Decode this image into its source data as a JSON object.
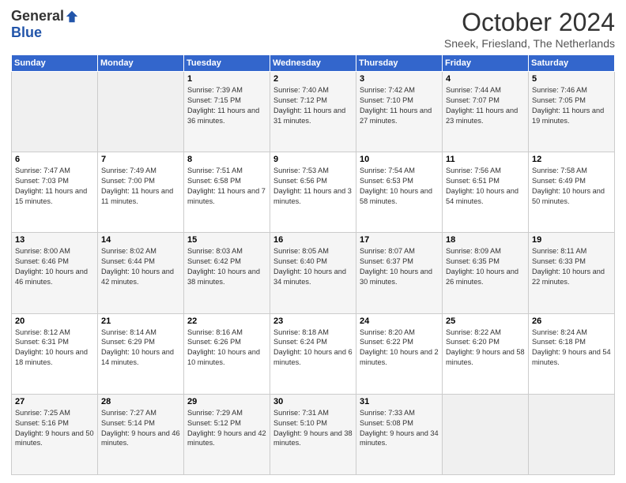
{
  "logo": {
    "general": "General",
    "blue": "Blue"
  },
  "title": "October 2024",
  "subtitle": "Sneek, Friesland, The Netherlands",
  "weekdays": [
    "Sunday",
    "Monday",
    "Tuesday",
    "Wednesday",
    "Thursday",
    "Friday",
    "Saturday"
  ],
  "weeks": [
    [
      {
        "day": "",
        "info": ""
      },
      {
        "day": "",
        "info": ""
      },
      {
        "day": "1",
        "info": "Sunrise: 7:39 AM\nSunset: 7:15 PM\nDaylight: 11 hours and 36 minutes."
      },
      {
        "day": "2",
        "info": "Sunrise: 7:40 AM\nSunset: 7:12 PM\nDaylight: 11 hours and 31 minutes."
      },
      {
        "day": "3",
        "info": "Sunrise: 7:42 AM\nSunset: 7:10 PM\nDaylight: 11 hours and 27 minutes."
      },
      {
        "day": "4",
        "info": "Sunrise: 7:44 AM\nSunset: 7:07 PM\nDaylight: 11 hours and 23 minutes."
      },
      {
        "day": "5",
        "info": "Sunrise: 7:46 AM\nSunset: 7:05 PM\nDaylight: 11 hours and 19 minutes."
      }
    ],
    [
      {
        "day": "6",
        "info": "Sunrise: 7:47 AM\nSunset: 7:03 PM\nDaylight: 11 hours and 15 minutes."
      },
      {
        "day": "7",
        "info": "Sunrise: 7:49 AM\nSunset: 7:00 PM\nDaylight: 11 hours and 11 minutes."
      },
      {
        "day": "8",
        "info": "Sunrise: 7:51 AM\nSunset: 6:58 PM\nDaylight: 11 hours and 7 minutes."
      },
      {
        "day": "9",
        "info": "Sunrise: 7:53 AM\nSunset: 6:56 PM\nDaylight: 11 hours and 3 minutes."
      },
      {
        "day": "10",
        "info": "Sunrise: 7:54 AM\nSunset: 6:53 PM\nDaylight: 10 hours and 58 minutes."
      },
      {
        "day": "11",
        "info": "Sunrise: 7:56 AM\nSunset: 6:51 PM\nDaylight: 10 hours and 54 minutes."
      },
      {
        "day": "12",
        "info": "Sunrise: 7:58 AM\nSunset: 6:49 PM\nDaylight: 10 hours and 50 minutes."
      }
    ],
    [
      {
        "day": "13",
        "info": "Sunrise: 8:00 AM\nSunset: 6:46 PM\nDaylight: 10 hours and 46 minutes."
      },
      {
        "day": "14",
        "info": "Sunrise: 8:02 AM\nSunset: 6:44 PM\nDaylight: 10 hours and 42 minutes."
      },
      {
        "day": "15",
        "info": "Sunrise: 8:03 AM\nSunset: 6:42 PM\nDaylight: 10 hours and 38 minutes."
      },
      {
        "day": "16",
        "info": "Sunrise: 8:05 AM\nSunset: 6:40 PM\nDaylight: 10 hours and 34 minutes."
      },
      {
        "day": "17",
        "info": "Sunrise: 8:07 AM\nSunset: 6:37 PM\nDaylight: 10 hours and 30 minutes."
      },
      {
        "day": "18",
        "info": "Sunrise: 8:09 AM\nSunset: 6:35 PM\nDaylight: 10 hours and 26 minutes."
      },
      {
        "day": "19",
        "info": "Sunrise: 8:11 AM\nSunset: 6:33 PM\nDaylight: 10 hours and 22 minutes."
      }
    ],
    [
      {
        "day": "20",
        "info": "Sunrise: 8:12 AM\nSunset: 6:31 PM\nDaylight: 10 hours and 18 minutes."
      },
      {
        "day": "21",
        "info": "Sunrise: 8:14 AM\nSunset: 6:29 PM\nDaylight: 10 hours and 14 minutes."
      },
      {
        "day": "22",
        "info": "Sunrise: 8:16 AM\nSunset: 6:26 PM\nDaylight: 10 hours and 10 minutes."
      },
      {
        "day": "23",
        "info": "Sunrise: 8:18 AM\nSunset: 6:24 PM\nDaylight: 10 hours and 6 minutes."
      },
      {
        "day": "24",
        "info": "Sunrise: 8:20 AM\nSunset: 6:22 PM\nDaylight: 10 hours and 2 minutes."
      },
      {
        "day": "25",
        "info": "Sunrise: 8:22 AM\nSunset: 6:20 PM\nDaylight: 9 hours and 58 minutes."
      },
      {
        "day": "26",
        "info": "Sunrise: 8:24 AM\nSunset: 6:18 PM\nDaylight: 9 hours and 54 minutes."
      }
    ],
    [
      {
        "day": "27",
        "info": "Sunrise: 7:25 AM\nSunset: 5:16 PM\nDaylight: 9 hours and 50 minutes."
      },
      {
        "day": "28",
        "info": "Sunrise: 7:27 AM\nSunset: 5:14 PM\nDaylight: 9 hours and 46 minutes."
      },
      {
        "day": "29",
        "info": "Sunrise: 7:29 AM\nSunset: 5:12 PM\nDaylight: 9 hours and 42 minutes."
      },
      {
        "day": "30",
        "info": "Sunrise: 7:31 AM\nSunset: 5:10 PM\nDaylight: 9 hours and 38 minutes."
      },
      {
        "day": "31",
        "info": "Sunrise: 7:33 AM\nSunset: 5:08 PM\nDaylight: 9 hours and 34 minutes."
      },
      {
        "day": "",
        "info": ""
      },
      {
        "day": "",
        "info": ""
      }
    ]
  ]
}
